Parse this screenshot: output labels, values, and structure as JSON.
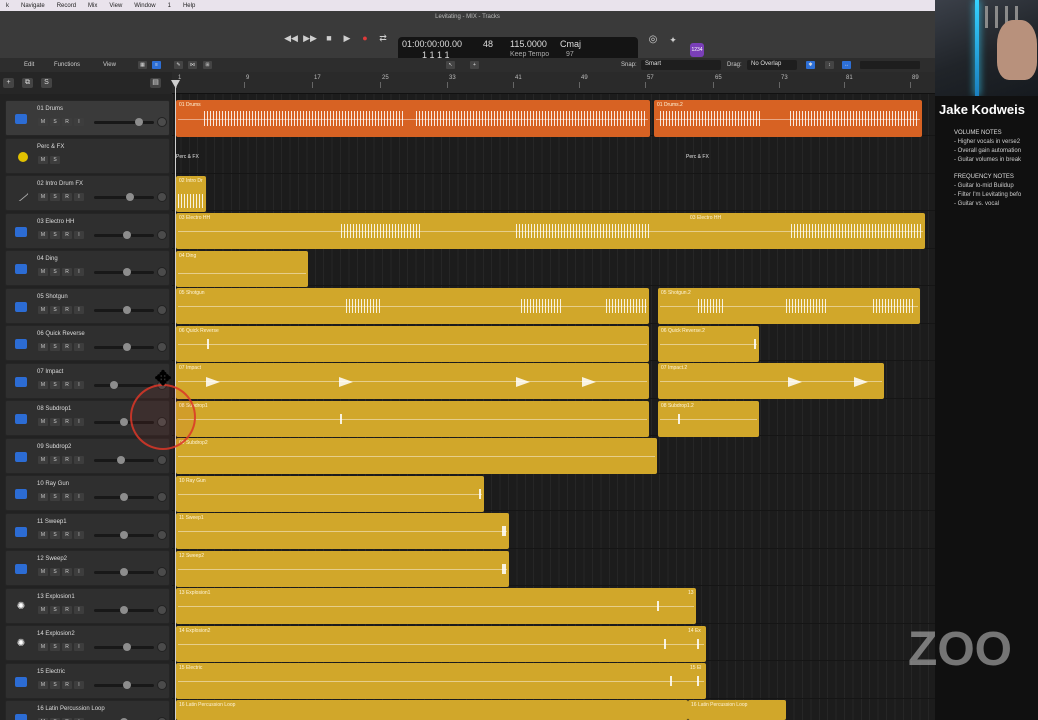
{
  "menubar": {
    "items": [
      "k",
      "Navigate",
      "Record",
      "Mix",
      "View",
      "Window",
      "1",
      "Help"
    ]
  },
  "window": {
    "title": "Levitating - MIX - Tracks"
  },
  "transport": {
    "time": "01:00:00:00.00",
    "position": "1   1   1   1",
    "bar_top": "48",
    "tempo": "115.0000",
    "tempo_mode": "Keep Tempo",
    "key": "Cmaj",
    "time_sig_bottom": "97",
    "badge": "1234"
  },
  "toolbar": {
    "edit": "Edit",
    "functions": "Functions",
    "view": "View",
    "snap_label": "Snap:",
    "snap_value": "Smart",
    "drag_label": "Drag:",
    "drag_value": "No Overlap"
  },
  "ruler": {
    "bars": [
      "1",
      "9",
      "17",
      "25",
      "33",
      "41",
      "49",
      "57",
      "65",
      "73",
      "81",
      "89"
    ]
  },
  "tracks": [
    {
      "name": "01 Drums",
      "color": "#d76223",
      "icon": "waveform"
    },
    {
      "name": "Perc & FX",
      "color": "#000000",
      "icon": "folder"
    },
    {
      "name": "02 Intro Drum FX",
      "color": "#d1a72a",
      "icon": "line"
    },
    {
      "name": "03 Electro HH",
      "color": "#d1a72a",
      "icon": "waveform"
    },
    {
      "name": "04 Ding",
      "color": "#d1a72a",
      "icon": "waveform"
    },
    {
      "name": "05 Shotgun",
      "color": "#d1a72a",
      "icon": "waveform"
    },
    {
      "name": "06 Quick Reverse",
      "color": "#d1a72a",
      "icon": "waveform"
    },
    {
      "name": "07 Impact",
      "color": "#d1a72a",
      "icon": "waveform"
    },
    {
      "name": "08 Subdrop1",
      "color": "#d1a72a",
      "icon": "waveform"
    },
    {
      "name": "09 Subdrop2",
      "color": "#d1a72a",
      "icon": "waveform"
    },
    {
      "name": "10 Ray Gun",
      "color": "#d1a72a",
      "icon": "waveform"
    },
    {
      "name": "11 Sweep1",
      "color": "#d1a72a",
      "icon": "waveform"
    },
    {
      "name": "12 Sweep2",
      "color": "#d1a72a",
      "icon": "waveform"
    },
    {
      "name": "13 Explosion1",
      "color": "#d1a72a",
      "icon": "star"
    },
    {
      "name": "14 Explosion2",
      "color": "#d1a72a",
      "icon": "star"
    },
    {
      "name": "15 Electric",
      "color": "#d1a72a",
      "icon": "waveform"
    },
    {
      "name": "16 Latin Percussion Loop",
      "color": "#d1a72a",
      "icon": "waveform"
    }
  ],
  "msri": [
    "M",
    "S",
    "R",
    "I"
  ],
  "regions": {
    "drums_a": "01 Drums",
    "drums_b": "01 Drums.2",
    "perc_a": "Perc & FX",
    "perc_b": "Perc & FX",
    "intro": "02 Intro Dr",
    "hh_a": "03 Electro HH",
    "hh_b": "03 Electro HH",
    "ding": "04 Ding",
    "shotgun_a": "05 Shotgun",
    "shotgun_b": "05 Shotgun.2",
    "qr_a": "06 Quick Reverse",
    "qr_b": "06 Quick Reverse.2",
    "impact_a": "07 Impact",
    "impact_b": "07 Impact.2",
    "sub1_a": "08 Subdrop1",
    "sub1_b": "08 Subdrop1.2",
    "sub2": "09 Subdrop2",
    "raygun": "10 Ray Gun",
    "sweep1": "11 Sweep1",
    "sweep2": "12 Sweep2",
    "exp1": "13 Explosion1",
    "exp1_end": "13",
    "exp2": "14 Explosion2",
    "exp2_end": "14 Ex",
    "elec": "15 Electric",
    "elec_end": "15 El",
    "latin_a": "16 Latin Percussion Loop",
    "latin_b": "16 Latin Percussion Loop"
  },
  "notes": {
    "speaker": "Jake Kodweis",
    "volume_title": "VOLUME NOTES",
    "volume_items": [
      "- Higher vocals in verse2",
      "- Overall gain automation",
      "- Guitar volumes in break"
    ],
    "freq_title": "FREQUENCY NOTES",
    "freq_items": [
      "- Guitar lo-mid Buildup",
      "- Filter I'm Levitating befo",
      "- Guitar vs. vocal"
    ]
  },
  "overlay": {
    "logo": "ZOO"
  }
}
